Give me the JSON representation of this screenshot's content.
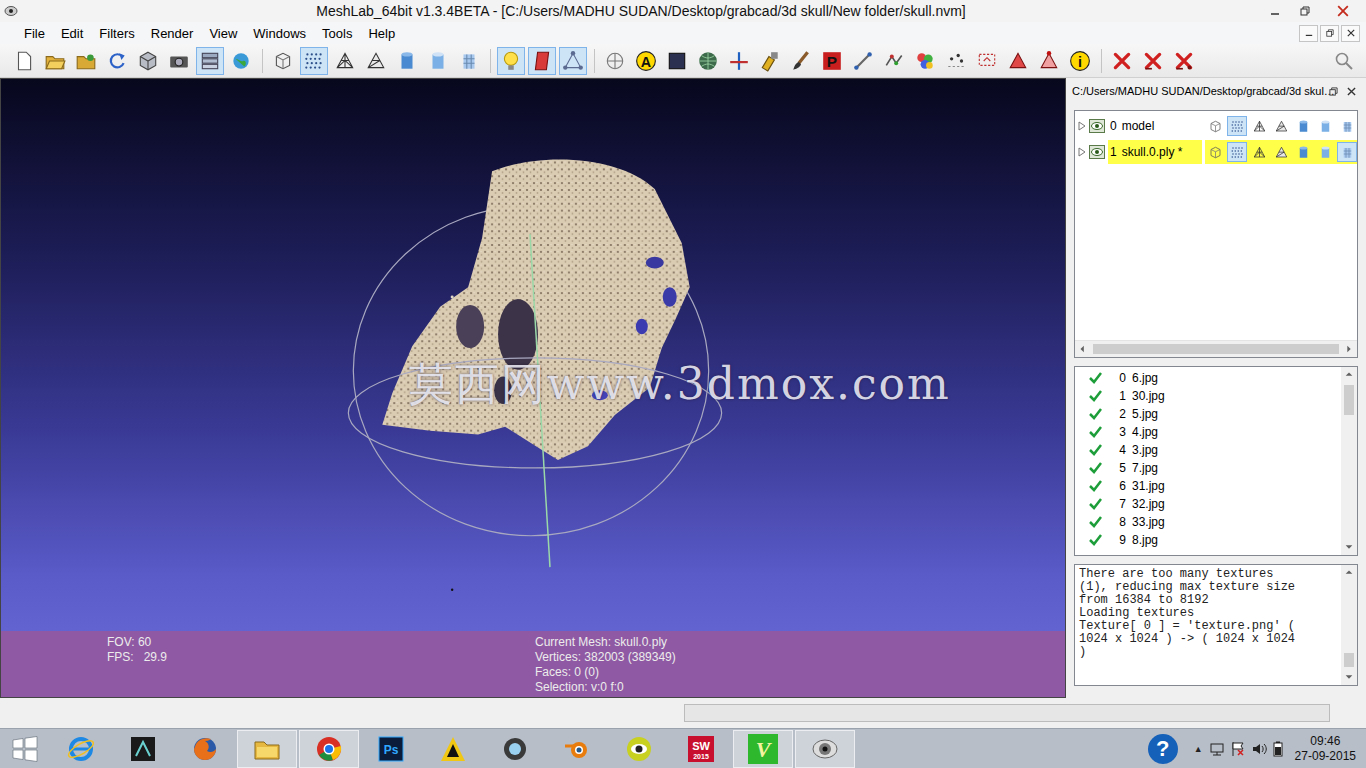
{
  "window": {
    "title": "MeshLab_64bit v1.3.4BETA - [C:/Users/MADHU SUDAN/Desktop/grabcad/3d skull/New folder/skull.nvm]"
  },
  "menu": [
    {
      "label": "File"
    },
    {
      "label": "Edit"
    },
    {
      "label": "Filters"
    },
    {
      "label": "Render"
    },
    {
      "label": "View"
    },
    {
      "label": "Windows"
    },
    {
      "label": "Tools"
    },
    {
      "label": "Help"
    }
  ],
  "toolbar": [
    [
      {
        "kind": "new",
        "selected": false
      },
      {
        "kind": "open",
        "selected": false
      },
      {
        "kind": "project",
        "selected": false
      },
      {
        "kind": "reload",
        "selected": false
      },
      {
        "kind": "export",
        "selected": false
      },
      {
        "kind": "snapshot",
        "selected": false
      },
      {
        "kind": "layers",
        "selected": true
      },
      {
        "kind": "raster",
        "selected": false
      }
    ],
    [
      {
        "kind": "bbox",
        "selected": false
      },
      {
        "kind": "points",
        "selected": true
      },
      {
        "kind": "wire",
        "selected": false
      },
      {
        "kind": "hidden",
        "selected": false
      },
      {
        "kind": "flat",
        "selected": false
      },
      {
        "kind": "smooth",
        "selected": false
      },
      {
        "kind": "textured",
        "selected": false
      }
    ],
    [
      {
        "kind": "light",
        "selected": true
      },
      {
        "kind": "backface",
        "selected": true
      },
      {
        "kind": "selvert",
        "selected": true
      }
    ],
    [
      {
        "kind": "grid",
        "selected": false
      },
      {
        "kind": "label",
        "glyph": "A",
        "selected": false
      },
      {
        "kind": "shader",
        "selected": false
      },
      {
        "kind": "sphere",
        "selected": false
      },
      {
        "kind": "axis",
        "selected": false
      },
      {
        "kind": "manip",
        "selected": false
      },
      {
        "kind": "brush",
        "selected": false
      },
      {
        "kind": "plugin",
        "glyph": "P",
        "selected": false
      },
      {
        "kind": "measure",
        "selected": false
      },
      {
        "kind": "align",
        "selected": false
      },
      {
        "kind": "paint",
        "selected": false
      },
      {
        "kind": "pick",
        "selected": false
      },
      {
        "kind": "select",
        "selected": false
      },
      {
        "kind": "selectc",
        "selected": false
      },
      {
        "kind": "selectv",
        "selected": false
      },
      {
        "kind": "info",
        "glyph": "i",
        "selected": false
      }
    ],
    [
      {
        "kind": "delv",
        "selected": false
      },
      {
        "kind": "delf",
        "selected": false
      },
      {
        "kind": "delfv",
        "selected": false
      }
    ]
  ],
  "viewport": {
    "watermark": "莫西网www.3dmox.com",
    "info_left": [
      "FOV: 60",
      "FPS:   29.9"
    ],
    "info_center": [
      "Current Mesh: skull.0.ply",
      "Vertices: 382003 (389349)",
      "Faces: 0 (0)",
      "Selection: v:0 f:0"
    ]
  },
  "layer_panel": {
    "title": "C:/Users/MADHU SUDAN/Desktop/grabcad/3d skul…",
    "mode_kinds": [
      "bbox",
      "points",
      "wire",
      "hidden",
      "flat",
      "smooth",
      "textured"
    ],
    "layers": [
      {
        "index": "0",
        "name": "model",
        "selected": false,
        "modes": [
          false,
          true,
          false,
          false,
          false,
          false,
          false
        ]
      },
      {
        "index": "1",
        "name": "skull.0.ply *",
        "selected": true,
        "modes": [
          false,
          true,
          false,
          false,
          false,
          false,
          true
        ]
      }
    ]
  },
  "rasters": [
    {
      "index": "0",
      "name": "6.jpg",
      "checked": true
    },
    {
      "index": "1",
      "name": "30.jpg",
      "checked": true
    },
    {
      "index": "2",
      "name": "5.jpg",
      "checked": true
    },
    {
      "index": "3",
      "name": "4.jpg",
      "checked": true
    },
    {
      "index": "4",
      "name": "3.jpg",
      "checked": true
    },
    {
      "index": "5",
      "name": "7.jpg",
      "checked": true
    },
    {
      "index": "6",
      "name": "31.jpg",
      "checked": true
    },
    {
      "index": "7",
      "name": "32.jpg",
      "checked": true
    },
    {
      "index": "8",
      "name": "33.jpg",
      "checked": true
    },
    {
      "index": "9",
      "name": "8.jpg",
      "checked": true
    }
  ],
  "log": [
    "There are too many textures",
    "(1), reducing max texture size",
    "from 16384 to 8192",
    "Loading textures",
    "Texture[ 0 ] = 'texture.png' (",
    "1024 x 1024 ) -> ( 1024 x 1024",
    ")"
  ],
  "status_bar": {
    "progress": {
      "level": 0
    }
  },
  "taskbar": {
    "apps": [
      {
        "kind": "ie",
        "glyph": "",
        "caption": "",
        "selected": false
      },
      {
        "kind": "max",
        "glyph": "",
        "caption": "",
        "selected": false
      },
      {
        "kind": "firefox",
        "glyph": "",
        "caption": "",
        "selected": false
      },
      {
        "kind": "explorer",
        "glyph": "",
        "caption": "",
        "selected": true
      },
      {
        "kind": "chrome",
        "glyph": "",
        "caption": "",
        "selected": true
      },
      {
        "kind": "photoshop",
        "glyph": "Ps",
        "caption": "",
        "selected": false
      },
      {
        "kind": "archicad",
        "glyph": "",
        "caption": "",
        "selected": false
      },
      {
        "kind": "keyshot",
        "glyph": "",
        "caption": "",
        "selected": false
      },
      {
        "kind": "blender",
        "glyph": "",
        "caption": "",
        "selected": false
      },
      {
        "kind": "viewer",
        "glyph": "",
        "caption": "",
        "selected": false
      },
      {
        "kind": "solidworks",
        "glyph": "SW",
        "caption": "2015",
        "selected": false
      },
      {
        "kind": "vcarve",
        "glyph": "V",
        "caption": "",
        "selected": true
      },
      {
        "kind": "meshlab",
        "glyph": "",
        "caption": "",
        "selected": true
      }
    ],
    "tray": {
      "help": "?",
      "expand": "▲",
      "time": "09:46",
      "date": "27-09-2015"
    }
  }
}
